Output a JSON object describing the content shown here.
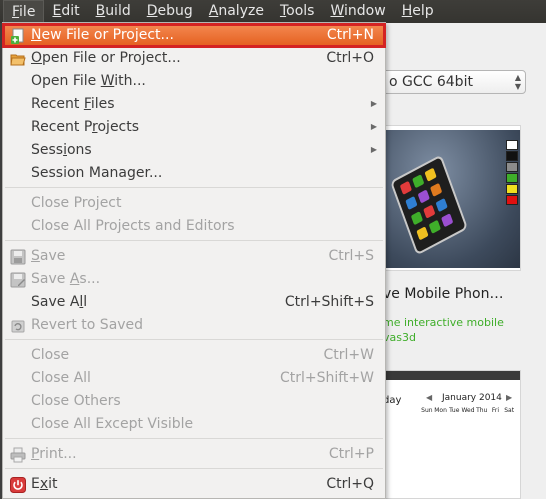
{
  "menubar": {
    "items": [
      {
        "key": "F",
        "rest": "ile"
      },
      {
        "key": "E",
        "rest": "dit"
      },
      {
        "key": "B",
        "rest": "uild"
      },
      {
        "key": "D",
        "rest": "ebug"
      },
      {
        "key": "A",
        "rest": "nalyze"
      },
      {
        "key": "T",
        "rest": "ools"
      },
      {
        "key": "W",
        "rest": "indow"
      },
      {
        "key": "H",
        "rest": "elp"
      }
    ]
  },
  "file_menu": {
    "new_file": {
      "pre": "",
      "key": "N",
      "post": "ew File or Project...",
      "shortcut": "Ctrl+N"
    },
    "open_file": {
      "pre": "",
      "key": "O",
      "post": "pen File or Project...",
      "shortcut": "Ctrl+O"
    },
    "open_with": {
      "pre": "Open File ",
      "key": "W",
      "post": "ith..."
    },
    "recent_files": {
      "pre": "Recent ",
      "key": "F",
      "post": "iles"
    },
    "recent_projects": {
      "pre": "Recent P",
      "key": "r",
      "post": "ojects"
    },
    "sessions": {
      "pre": "Sess",
      "key": "i",
      "post": "ons"
    },
    "session_manager": {
      "pre": "Session Manager..."
    },
    "close_project": {
      "pre": "Close Project"
    },
    "close_all_projects": {
      "pre": "Close All Projects and Editors"
    },
    "save": {
      "pre": "",
      "key": "S",
      "post": "ave",
      "shortcut": "Ctrl+S"
    },
    "save_as": {
      "pre": "Save ",
      "key": "A",
      "post": "s..."
    },
    "save_all": {
      "pre": "Save A",
      "key": "l",
      "post": "l",
      "shortcut": "Ctrl+Shift+S"
    },
    "revert": {
      "pre": "Revert to Saved"
    },
    "close": {
      "pre": "Close",
      "shortcut": "Ctrl+W"
    },
    "close_all": {
      "pre": "Close All",
      "shortcut": "Ctrl+Shift+W"
    },
    "close_others": {
      "pre": "Close Others"
    },
    "close_all_except": {
      "pre": "Close All Except Visible"
    },
    "print": {
      "pre": "",
      "key": "P",
      "post": "rint...",
      "shortcut": "Ctrl+P"
    },
    "exit": {
      "pre": "E",
      "key": "x",
      "post": "it",
      "shortcut": "Ctrl+Q"
    }
  },
  "background": {
    "kit_selector": "o GCC 64bit",
    "example_title": "ve Mobile Phon…",
    "example_desc_1": "me interactive mobile",
    "example_desc_2": "vas3d",
    "calendar_today": "day",
    "calendar_month": "January 2014",
    "calendar_days": [
      "Sun",
      "Mon",
      "Tue",
      "Wed",
      "Thu",
      "Fri",
      "Sat"
    ]
  },
  "colors": {
    "highlight": "#e8672a",
    "highlight_outline": "#d42323",
    "menubar": "#3a3935",
    "disabled_text": "#a3a3a3",
    "link_green": "#3fae2a"
  }
}
